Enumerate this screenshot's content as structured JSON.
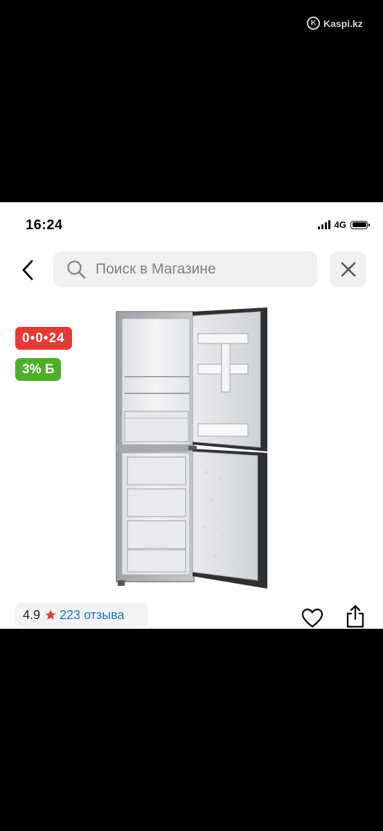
{
  "watermark": {
    "logo_letter": "K",
    "text": "Kaspi.kz"
  },
  "status_bar": {
    "time": "16:24",
    "network": "4G",
    "signal_bars": 4,
    "battery_level": 1.0
  },
  "header": {
    "back_icon": "chevron-left-icon",
    "search": {
      "placeholder": "Поиск в Магазине",
      "value": "",
      "icon": "search-icon"
    },
    "close_icon": "close-icon"
  },
  "product": {
    "image_description": "fridge-image",
    "badges": {
      "installment": "0•0•24",
      "bonus": "3% Б"
    },
    "rating": {
      "value": "4.9",
      "star_color": "#e53e2d",
      "reviews": "223 отзыва"
    },
    "actions": {
      "favorite_icon": "heart-icon",
      "share_icon": "share-icon"
    }
  },
  "colors": {
    "installment": "#e53935",
    "bonus": "#4caf26",
    "link": "#1b73c3"
  }
}
